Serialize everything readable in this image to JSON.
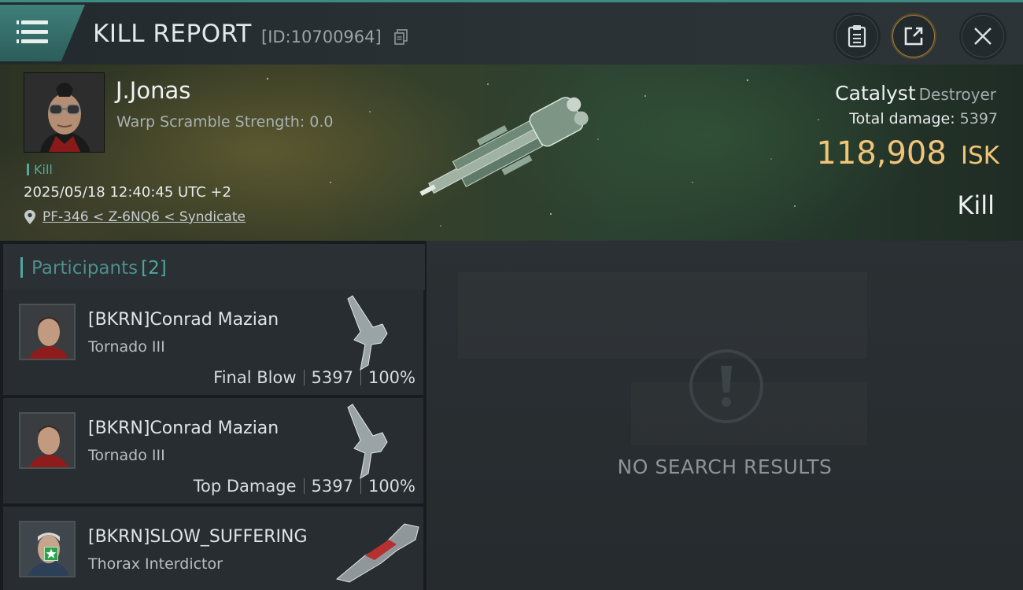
{
  "header": {
    "title": "KILL REPORT",
    "id_text": "[ID:10700964]",
    "menu_icon": "hamburger-menu-icon",
    "buttons": [
      "clipboard-icon",
      "share-icon",
      "close-icon"
    ]
  },
  "victim": {
    "name": "J.Jonas",
    "warp_scramble": "Warp Scramble Strength: 0.0",
    "tag": "Kill",
    "datetime": "2025/05/18 12:40:45 UTC +2",
    "location": "PF-346 < Z-6NQ6 < Syndicate",
    "ship_name": "Catalyst",
    "ship_class": "Destroyer",
    "total_damage_label": "Total damage:",
    "total_damage_value": "5397",
    "isk_amount": "118,908",
    "isk_unit": "ISK",
    "kind": "Kill"
  },
  "participants": {
    "label": "Participants",
    "count": "[2]",
    "rows": [
      {
        "name": "[BKRN]Conrad Mazian",
        "ship": "Tornado III",
        "role": "Final Blow",
        "damage": "5397",
        "percent": "100%"
      },
      {
        "name": "[BKRN]Conrad Mazian",
        "ship": "Tornado III",
        "role": "Top Damage",
        "damage": "5397",
        "percent": "100%"
      },
      {
        "name": "[BKRN]SLOW_SUFFERING",
        "ship": "Thorax Interdictor"
      }
    ]
  },
  "results": {
    "empty_text": "NO SEARCH RESULTS",
    "icon": "exclamation-circle-icon"
  },
  "colors": {
    "accent": "#4fa7a0",
    "isk": "#f1c578",
    "share_ring": "#9b7b3e"
  }
}
